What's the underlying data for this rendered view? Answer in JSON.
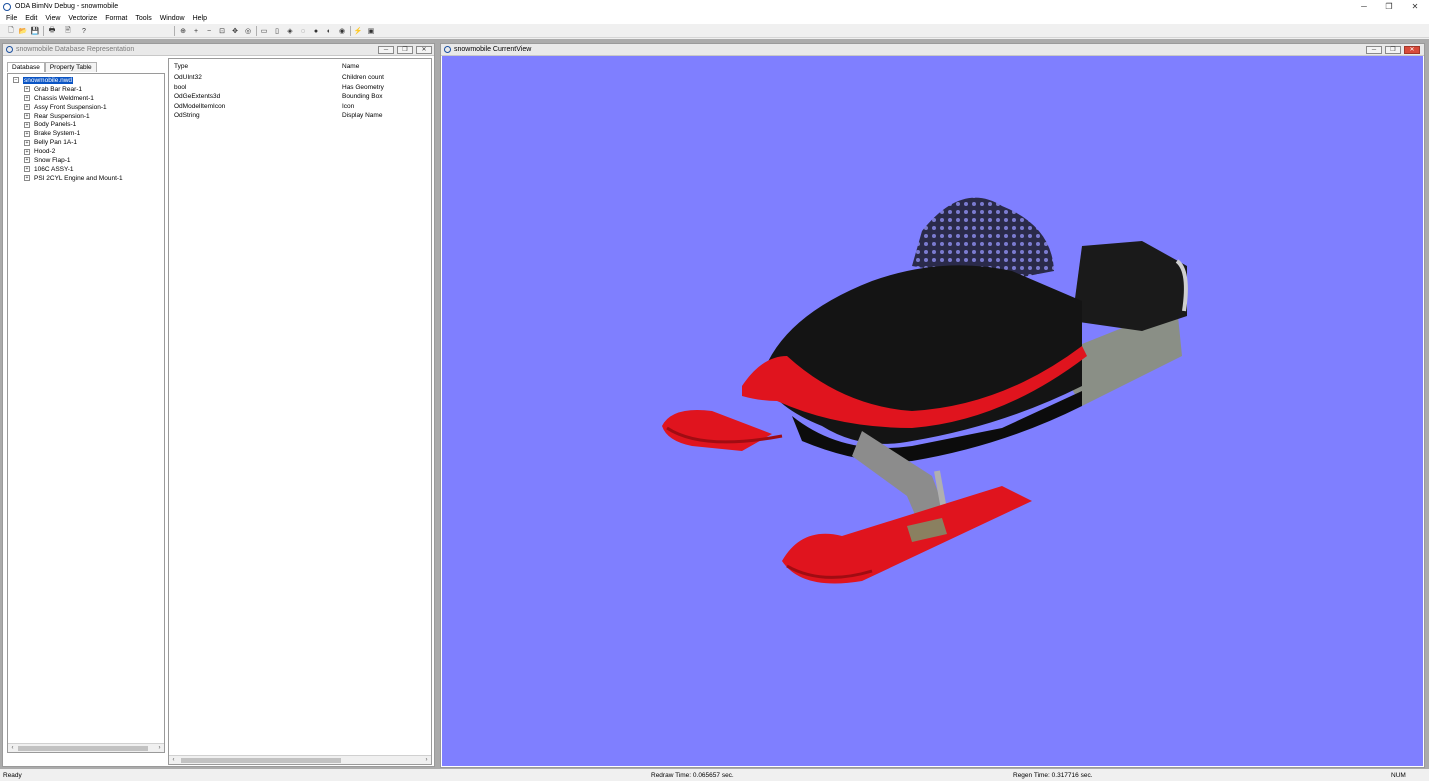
{
  "app": {
    "title": "ODA BimNv Debug - snowmobile",
    "controls": {
      "minimize": "─",
      "restore": "❐",
      "close": "✕"
    }
  },
  "menu": [
    "File",
    "Edit",
    "View",
    "Vectorize",
    "Format",
    "Tools",
    "Window",
    "Help"
  ],
  "toolbar_icons": {
    "new": "🗋",
    "open": "📂",
    "save": "💾",
    "print": "🖶",
    "print_preview": "🖹",
    "help": "?",
    "zoom_extents": "⊕",
    "zoom_in": "+",
    "zoom_out": "−",
    "zoom_window": "⊡",
    "pan": "✥",
    "orbit": "◎",
    "view_top": "▭",
    "view_front": "▯",
    "view_iso": "◈",
    "shade_wire": "◌",
    "shade_hidden": "●",
    "shade_flat": "◐",
    "shade_gouraud": "◉",
    "shade_smooth": "◍",
    "lightning": "⚡",
    "settings": "▣"
  },
  "db_window": {
    "title": "snowmobile Database Representation",
    "tabs": [
      "Database",
      "Property Table"
    ],
    "root": "snowmobile.nwd",
    "items": [
      "Grab Bar Rear-1",
      "Chassis Weldment-1",
      "Assy Front Suspension-1",
      "Rear Suspension-1",
      "Body Panels-1",
      "Brake System-1",
      "Belly Pan 1A-1",
      "Hood-2",
      "Snow Flap-1",
      "106C ASSY-1",
      "PSI 2CYL Engine and Mount-1"
    ],
    "expand_glyph": "+",
    "collapse_glyph": "−"
  },
  "properties": {
    "headers": {
      "type": "Type",
      "name": "Name"
    },
    "rows": [
      {
        "type": "OdUInt32",
        "name": "Children count"
      },
      {
        "type": "bool",
        "name": "Has Geometry"
      },
      {
        "type": "OdGeExtents3d",
        "name": "Bounding Box"
      },
      {
        "type": "OdModelItemIcon",
        "name": "Icon"
      },
      {
        "type": "OdString",
        "name": "Display Name"
      }
    ]
  },
  "view_window": {
    "title": "snowmobile CurrentView",
    "background_color": "#7f7fff"
  },
  "scroll": {
    "left": "‹",
    "right": "›"
  },
  "status": {
    "ready": "Ready",
    "redraw": "Redraw Time: 0.065657 sec.",
    "regen": "Regen Time: 0.317716 sec.",
    "num": "NUM"
  },
  "colors": {
    "selection": "#0a54c4",
    "ski_red": "#e0141e",
    "body_black": "#141414"
  }
}
